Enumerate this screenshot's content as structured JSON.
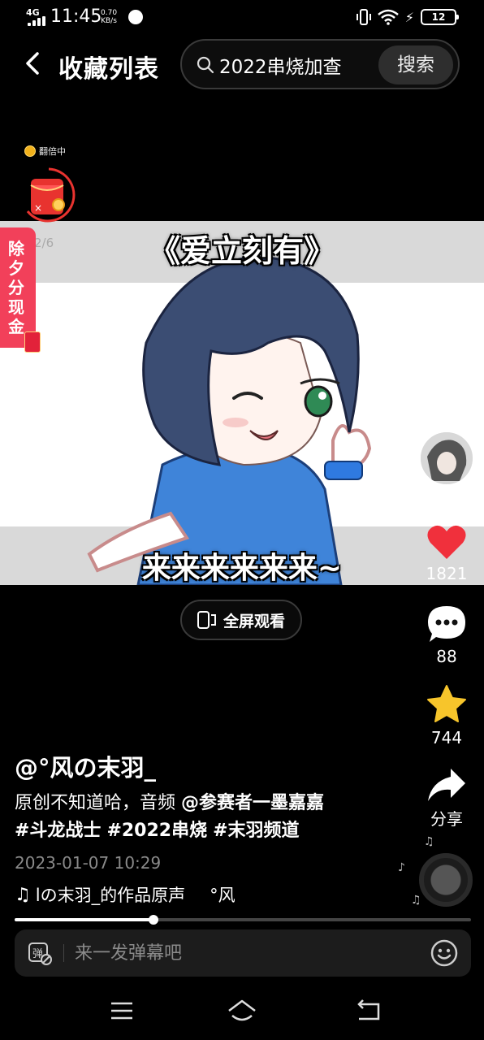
{
  "status_bar": {
    "network": "4G",
    "time": "11:45",
    "speed_value": "0.70",
    "speed_unit": "KB/s",
    "battery": "12"
  },
  "header": {
    "back_icon": "chevron-left-icon",
    "title": "收藏列表",
    "search_value": "2022串烧加查",
    "search_button": "搜索"
  },
  "video": {
    "subtitle_top": "《爱立刻有》",
    "subtitle_bottom": "来来来来来来~"
  },
  "promo": {
    "double_label": "翻倍中",
    "packet_progress": "2/6",
    "new_year_tab": "除夕分现金"
  },
  "actions": {
    "like_count": "1821",
    "comment_count": "88",
    "favorite_count": "744",
    "share_label": "分享"
  },
  "fullscreen": {
    "label": "全屏观看"
  },
  "post": {
    "author": "@°风の末羽_",
    "desc_text": "原创不知道哈，音频 ",
    "mention": "@参赛者一墨嘉嘉",
    "tags": [
      "#斗龙战士",
      "#2022串烧",
      "#末羽频道"
    ],
    "date": "2023-01-07 10:29",
    "music": "lの末羽_的作品原声",
    "music_author": "°风"
  },
  "playback": {
    "progress": 0.305
  },
  "danmaku": {
    "placeholder": "来一发弹幕吧"
  },
  "colors": {
    "like_red": "#f0303c",
    "favorite_yellow": "#f7c52b",
    "new_year_pink": "#f2405a"
  }
}
